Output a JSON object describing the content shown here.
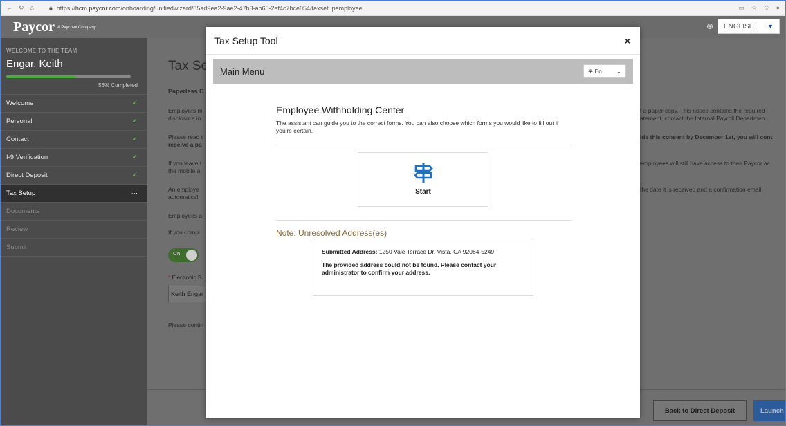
{
  "browser": {
    "url_prefix": "https://",
    "url_host": "hcm.paycor.com",
    "url_path": "/onboarding/unifiedwizard/85ad9ea2-9ae2-47b3-ab65-2ef4c7bce054/taxsetupemployee"
  },
  "header": {
    "logo": "Paycor",
    "logo_sub": "A Paychex Company",
    "language": "ENGLISH"
  },
  "sidebar": {
    "welcome": "WELCOME TO THE TEAM",
    "name": "Engar, Keith",
    "progress": 0.56,
    "progress_label": "56% Completed",
    "items": [
      {
        "label": "Welcome",
        "state": "done"
      },
      {
        "label": "Personal",
        "state": "done"
      },
      {
        "label": "Contact",
        "state": "done"
      },
      {
        "label": "I-9 Verification",
        "state": "done"
      },
      {
        "label": "Direct Deposit",
        "state": "done"
      },
      {
        "label": "Tax Setup",
        "state": "active",
        "marker": "···"
      },
      {
        "label": "Documents",
        "state": "pending"
      },
      {
        "label": "Review",
        "state": "pending"
      },
      {
        "label": "Submit",
        "state": "pending"
      }
    ]
  },
  "main": {
    "title": "Tax Se",
    "heading": "Paperless C",
    "para1a": "Employers m",
    "para1b": "disclosure in",
    "para2a": "Please read t",
    "para2b": "receive a pa",
    "para3a": "If you leave t",
    "para3b": "the mobile a",
    "para4a": "An employe",
    "para4b": "automaticall",
    "para5": "Employees a",
    "para6": "If you compl",
    "right1a": "f a paper copy. This notice contains the required",
    "right1b": "atement, contact the Internal Payroll Departmen",
    "right2": "ide this consent by December 1st, you will cont",
    "right3": "employees will still have access to their Paycor ac",
    "right4": "the date it is received and a confirmation email",
    "toggle": "ON",
    "esig_label": "Electronic S",
    "esig_value": "Keith Engar",
    "continue": "Please contin",
    "back_button": "Back to Direct Deposit",
    "launch_button": "Launch"
  },
  "modal": {
    "title": "Tax Setup Tool",
    "close": "×",
    "menu": "Main Menu",
    "lang": "En",
    "center_title": "Employee Withholding Center",
    "center_desc": "The assistant can guide you to the correct forms. You can also choose which forms you would like to fill out if you're certain.",
    "start": "Start",
    "note": "Note: Unresolved Address(es)",
    "addr_label": "Submitted Address:",
    "addr_value": "1250 Vale Terrace Dr, Vista, CA 92084-5249",
    "addr_warning": "The provided address could not be found. Please contact your administrator to confirm your address."
  },
  "colors": {
    "accent": "#1a73c8",
    "check": "#6fcc5a",
    "progress": "#4caa3c",
    "note": "#8a6a3a"
  }
}
